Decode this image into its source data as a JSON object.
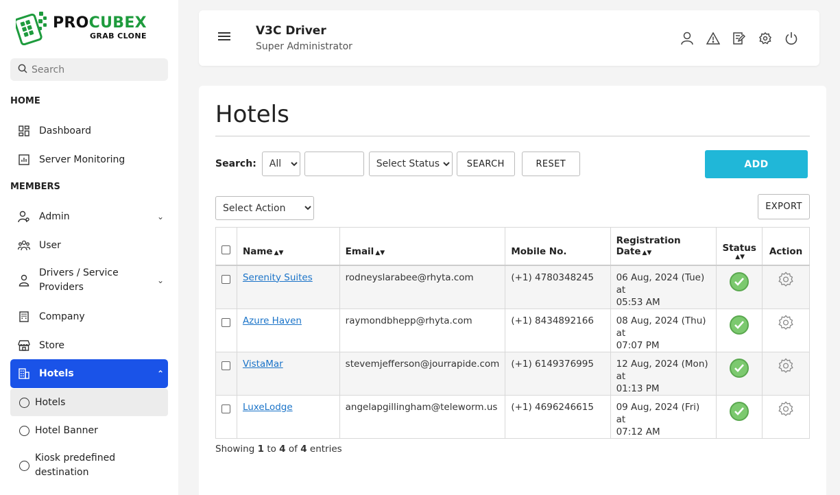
{
  "brand": {
    "title_a": "PRO",
    "title_b": "CUBEX",
    "subtitle": "GRAB CLONE"
  },
  "sidebar": {
    "search_placeholder": "Search",
    "sections": {
      "home": "HOME",
      "members": "MEMBERS"
    },
    "items": {
      "dashboard": "Dashboard",
      "server_monitoring": "Server Monitoring",
      "admin": "Admin",
      "user": "User",
      "drivers_line1": "Drivers / Service",
      "drivers_line2": "Providers",
      "company": "Company",
      "store": "Store",
      "hotels": "Hotels"
    },
    "sub_items": {
      "hotels": "Hotels",
      "hotel_banner": "Hotel Banner",
      "kiosk_line1": "Kiosk predefined",
      "kiosk_line2": "destination"
    }
  },
  "header": {
    "name": "V3C Driver",
    "role": "Super Administrator"
  },
  "page": {
    "title": "Hotels",
    "search_label": "Search:",
    "filter_all": "All",
    "status_placeholder": "Select Status",
    "search_button": "SEARCH",
    "reset_button": "RESET",
    "add_button": "ADD",
    "action_placeholder": "Select Action",
    "export_button": "EXPORT"
  },
  "table": {
    "columns": {
      "name": "Name",
      "email": "Email",
      "mobile": "Mobile No.",
      "reg_date": "Registration Date",
      "status": "Status",
      "action": "Action"
    },
    "rows": [
      {
        "name": "Serenity Suites",
        "email": "rodneyslarabee@rhyta.com",
        "mobile": "(+1) 4780348245",
        "date1": "06 Aug, 2024 (Tue) at",
        "date2": "05:53 AM"
      },
      {
        "name": "Azure Haven",
        "email": "raymondbhepp@rhyta.com",
        "mobile": "(+1) 8434892166",
        "date1": "08 Aug, 2024 (Thu) at",
        "date2": "07:07 PM"
      },
      {
        "name": "VistaMar",
        "email": "stevemjefferson@jourrapide.com",
        "mobile": "(+1) 6149376995",
        "date1": "12 Aug, 2024 (Mon) at",
        "date2": "01:13 PM"
      },
      {
        "name": "LuxeLodge",
        "email": "angelapgillingham@teleworm.us",
        "mobile": "(+1) 4696246615",
        "date1": "09 Aug, 2024 (Fri) at",
        "date2": "07:12 AM"
      }
    ]
  },
  "footer": {
    "showing_prefix": "Showing",
    "from": "1",
    "to_word": "to",
    "to": "4",
    "of_word": "of",
    "total": "4",
    "suffix": "entries"
  },
  "colors": {
    "accent": "#1a53e8",
    "add_button": "#20b7d8",
    "status_ok": "#7cc96f",
    "brand_green": "#1e9b3d"
  }
}
